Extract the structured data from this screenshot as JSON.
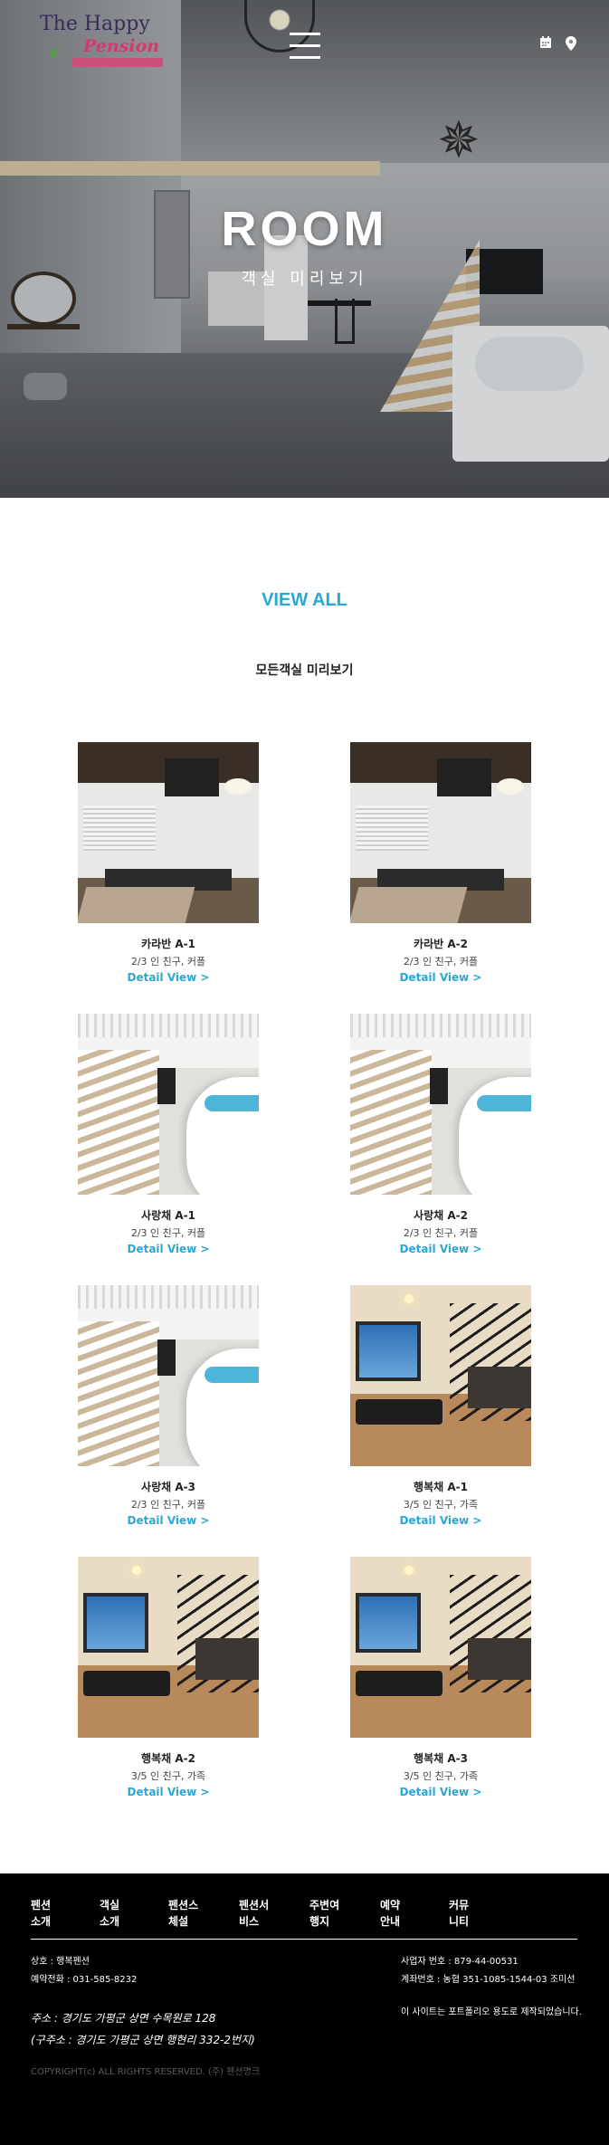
{
  "header": {
    "logo_line1": "The Happy",
    "logo_line2": "Pension",
    "icons": [
      "menu-icon",
      "calendar-icon",
      "map-pin-icon"
    ]
  },
  "hero": {
    "title": "ROOM",
    "subtitle": "객실 미리보기"
  },
  "section": {
    "view_all": "VIEW ALL",
    "subtitle": "모든객실 미리보기"
  },
  "rooms": [
    {
      "name": "카라반 A-1",
      "capacity": "2/3 인 친구, 커플",
      "detail": "Detail View >",
      "type": "caravan"
    },
    {
      "name": "카라반 A-2",
      "capacity": "2/3 인 친구, 커플",
      "detail": "Detail View >",
      "type": "caravan"
    },
    {
      "name": "사랑채 A-1",
      "capacity": "2/3 인 친구, 커플",
      "detail": "Detail View >",
      "type": "spa"
    },
    {
      "name": "사랑채 A-2",
      "capacity": "2/3 인 친구, 커플",
      "detail": "Detail View >",
      "type": "spa"
    },
    {
      "name": "사랑채 A-3",
      "capacity": "2/3 인 친구, 커플",
      "detail": "Detail View >",
      "type": "spa"
    },
    {
      "name": "행복채 A-1",
      "capacity": "3/5 인 친구, 가족",
      "detail": "Detail View >",
      "type": "happy"
    },
    {
      "name": "행복채 A-2",
      "capacity": "3/5 인 친구, 가족",
      "detail": "Detail View >",
      "type": "happy"
    },
    {
      "name": "행복채 A-3",
      "capacity": "3/5 인 친구, 가족",
      "detail": "Detail View >",
      "type": "happy"
    }
  ],
  "footer": {
    "nav": [
      {
        "line1": "펜션",
        "line2": "소개"
      },
      {
        "line1": "객실",
        "line2": "소개"
      },
      {
        "line1": "펜션스",
        "line2": "체설"
      },
      {
        "line1": "펜션서",
        "line2": "비스"
      },
      {
        "line1": "주변여",
        "line2": "행지"
      },
      {
        "line1": "예약",
        "line2": "안내"
      },
      {
        "line1": "커뮤",
        "line2": "니티"
      }
    ],
    "company": "상호 : 행복펜션",
    "phone": "예약전화 : 031-585-8232",
    "biz_no": "사업자 번호 : 879-44-00531",
    "account": "계좌번호 : 농협 351-1085-1544-03 조미선",
    "note": "이 사이트는 포트폴리오 용도로 제작되었습니다.",
    "address": "주소 : 경기도 가평군 상면 수목원로 128",
    "address_old": "(구주소 : 경기도 가평군 상면 행현리 332-2번지)",
    "copyright": "COPYRIGHT(c) ALL RIGHTS RESERVED. (주) 펜션명크"
  },
  "colors": {
    "accent": "#2aa7d4",
    "footer_bg": "#000000"
  }
}
